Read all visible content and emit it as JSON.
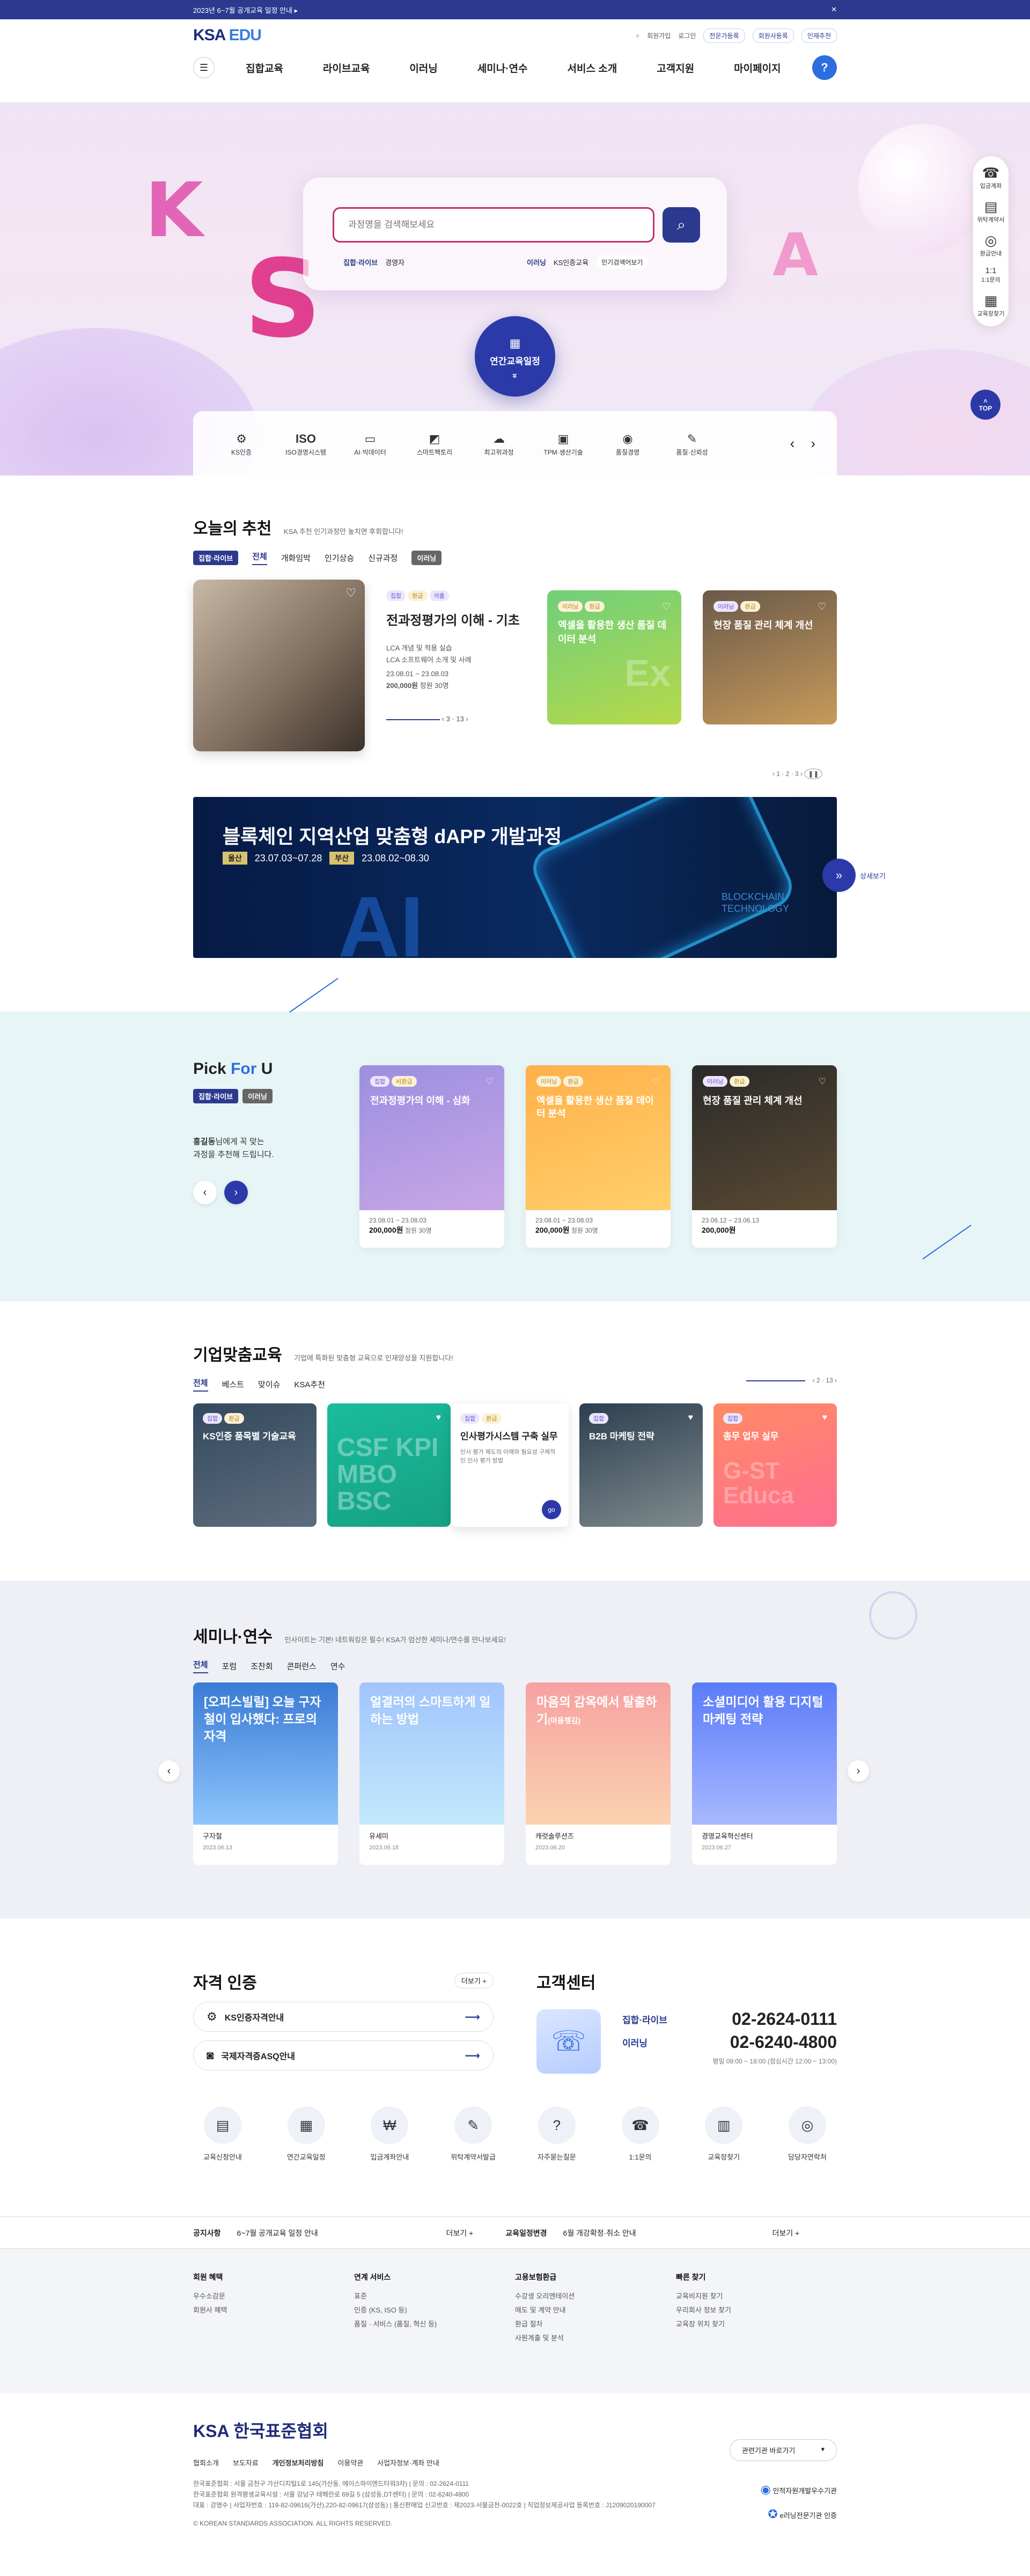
{
  "topbar": {
    "notice": "2023년 6~7월 공개교육 일정 안내 ▸",
    "close": "✕"
  },
  "header": {
    "logo_main": "KSA",
    "logo_sub": " EDU",
    "util": [
      "회원가입",
      "로그인"
    ],
    "util_pills": [
      "전문가등록",
      "회원사등록",
      "인재추천"
    ],
    "gnb": [
      "집합교육",
      "라이브교육",
      "이러닝",
      "세미나·연수",
      "서비스 소개",
      "고객지원",
      "마이페이지"
    ],
    "help": "?"
  },
  "hero": {
    "search_placeholder": "과정명을 검색해보세요",
    "hash": [
      {
        "label": "집합·라이브",
        "value": "경영자"
      },
      {
        "label": "이러닝",
        "value": "KS인증교육"
      }
    ],
    "chip": "인기검색어보기",
    "year_btn": "연간교육일정",
    "year_arrow": "»",
    "quick": [
      {
        "icon": "⚙",
        "label": "KS인증"
      },
      {
        "icon": "ISO",
        "label": "ISO경영시스템"
      },
      {
        "icon": "▭",
        "label": "AI·빅데이터"
      },
      {
        "icon": "◩",
        "label": "스마트팩토리"
      },
      {
        "icon": "☁",
        "label": "최고위과정"
      },
      {
        "icon": "▣",
        "label": "TPM·생산기술"
      },
      {
        "icon": "◉",
        "label": "품질경영"
      },
      {
        "icon": "✎",
        "label": "품질·신뢰성"
      }
    ],
    "quick_nav": [
      "‹",
      "›"
    ],
    "side": [
      {
        "icon": "☎",
        "label": "입금계좌"
      },
      {
        "icon": "▤",
        "label": "위탁계약서"
      },
      {
        "icon": "◎",
        "label": "환급안내"
      },
      {
        "icon": "1:1",
        "label": "1:1문의"
      },
      {
        "icon": "▦",
        "label": "교육장찾기"
      }
    ],
    "top": "TOP"
  },
  "today": {
    "title": "오늘의 추천",
    "sub": "KSA 추천 인기과정만 놓치면 후회합니다!",
    "badges": [
      "집합·라이브",
      "이러닝"
    ],
    "tabs": [
      "전체",
      "개화임박",
      "인기상승",
      "신규과정"
    ],
    "main": {
      "tags": [
        "집합",
        "환급",
        "석출"
      ],
      "title": "전과정평가의 이해 - 기초",
      "desc1": "LCA 개념 및 적용 실습",
      "desc2": "LCA 소프트웨어 소개 및 사례",
      "date": "23.08.01 ~ 23.08.03",
      "price": "200,000원",
      "seats": "정원 30명",
      "pager": "3 · 13"
    },
    "cards": [
      {
        "tags": [
          "이러닝",
          "환급"
        ],
        "title": "엑셀을 활용한 생산 품질 데이터 분석",
        "bg": "Ex"
      },
      {
        "tags": [
          "이러닝",
          "환급"
        ],
        "title": "현장 품질 관리 체계 개선"
      }
    ],
    "pager": "1 · 2 · 3"
  },
  "banner": {
    "title": "블록체인 지역산업 맞춤형 dAPP 개발과정",
    "d1k": "울산",
    "d1": "23.07.03~07.28",
    "d2k": "부산",
    "d2": "23.08.02~08.30",
    "ai": "AI",
    "bc": "BLOCKCHAIN",
    "bc2": "TECHNOLOGY",
    "more": "상세보기"
  },
  "pick": {
    "title_a": "Pick ",
    "title_b": "For",
    "title_c": " U",
    "badges": [
      "집합·라이브",
      "이러닝"
    ],
    "name": "홍길동",
    "desc1": "님에게 꼭 맞는",
    "desc2": "과정을 추천해 드립니다.",
    "cards": [
      {
        "tags": [
          "집합",
          "비환급"
        ],
        "title": "전과정평가의 이해 - 심화",
        "date": "23.08.01 ~ 23.08.03",
        "price": "200,000원",
        "seats": "정원 30명"
      },
      {
        "tags": [
          "이러닝",
          "환급"
        ],
        "title": "엑셀을 활용한 생산 품질 데이터 분석",
        "date": "23.08.01 ~ 23.08.03",
        "price": "200,000원",
        "seats": "정원 30명"
      },
      {
        "tags": [
          "이러닝",
          "환급"
        ],
        "title": "현장 품질 관리 체계 개선",
        "date": "23.06.12 ~ 23.06.13",
        "price": "200,000원",
        "seats": ""
      }
    ]
  },
  "corp": {
    "title": "기업맞춤교육",
    "sub": "기업에 특화된 맞춤형 교육으로 인재양성을 지원합니다!",
    "tabs": [
      "전체",
      "베스트",
      "맞이슈",
      "KSA추천"
    ],
    "pager": "2 · 13",
    "cards": [
      {
        "tags": [
          "집합",
          "환급"
        ],
        "title": "KS인증 품목별 기술교육"
      },
      {
        "title": "",
        "bg": "CSF KPI MBO BSC"
      },
      {
        "tags": [
          "집합",
          "환급"
        ],
        "title": "인사평가시스템 구축 실무",
        "desc": "인사 평가 제도의 이해와 필요성 구체적인 인사 평가 방법"
      },
      {
        "tags": [
          "집합"
        ],
        "title": "B2B 마케팅 전략"
      },
      {
        "tags": [
          "집합"
        ],
        "title": "총무 업무 실무",
        "bg": "G-ST Educa"
      }
    ]
  },
  "seminar": {
    "title": "세미나·연수",
    "sub": "인사이트는 기본! 네트워킹은 필수! KSA가 엄선한 세미나/연수를 만나보세요!",
    "tabs": [
      "전체",
      "포럼",
      "조찬회",
      "콘퍼런스",
      "연수"
    ],
    "cards": [
      {
        "title": "[오피스빌릴] 오늘 구자철이 입사했다: 프로의 자격",
        "name": "구자철",
        "date": "2023.06.13"
      },
      {
        "title": "얼결러의 스마트하게 일하는 방법",
        "name": "유세미",
        "date": "2023.06.18"
      },
      {
        "title": "마음의 감옥에서 탈출하기",
        "title_sub": "(마음챙김)",
        "name": "캐럿솔루션즈",
        "date": "2023.06.20"
      },
      {
        "title": "소셜미디어 활용 디지털 마케팅 전략",
        "name": "경영교육혁신센터",
        "date": "2023.06.27"
      }
    ]
  },
  "cert": {
    "title": "자격 인증",
    "more": "더보기 +",
    "items": [
      "KS인증자격안내",
      "국제자격증ASQ안내"
    ]
  },
  "cs": {
    "title": "고객센터",
    "rows": [
      {
        "label": "집합·라이브",
        "num": "02-2624-0111"
      },
      {
        "label": "이러닝",
        "num": "02-6240-4800"
      }
    ],
    "hours": "평일 09:00 ~ 18:00 (점심시간 12:00 ~ 13:00)"
  },
  "qicons": [
    {
      "icon": "▤",
      "label": "교육신청안내"
    },
    {
      "icon": "▦",
      "label": "연간교육일정"
    },
    {
      "icon": "₩",
      "label": "입금계좌안내"
    },
    {
      "icon": "✎",
      "label": "위탁계약서발급"
    },
    {
      "icon": "?",
      "label": "자주묻는질문"
    },
    {
      "icon": "☎",
      "label": "1:1문의"
    },
    {
      "icon": "▥",
      "label": "교육장찾기"
    },
    {
      "icon": "◎",
      "label": "담당자연락처"
    }
  ],
  "notice": {
    "l1": "공지사항",
    "t1": "6~7월 공개교육 일정 안내",
    "m1": "더보기 +",
    "l2": "교육일정변경",
    "t2": "6월 개강확정·취소 안내",
    "m2": "더보기 +"
  },
  "sitemap": [
    {
      "h": "회원 혜택",
      "items": [
        "우수소감문",
        "회원사 혜택"
      ]
    },
    {
      "h": "연계 서비스",
      "items": [
        "표준",
        "인증 (KS, ISO 등)",
        "품질 · 서비스 (품질, 혁신 등)"
      ]
    },
    {
      "h": "고용보험환급",
      "items": [
        "수강생 오리엔테이션",
        "매도 및 계약 안내",
        "환급 절차",
        "사원계출 및 분석"
      ]
    },
    {
      "h": "빠른 찾기",
      "items": [
        "교육비지원 찾기",
        "우리회사 정보 찾기",
        "교육장 위치 찾기"
      ]
    }
  ],
  "footer": {
    "logo": "KSA 한국표준협회",
    "links": [
      "협회소개",
      "보도자료",
      "개인정보처리방침",
      "이용약관",
      "사업자정보·계좌 안내"
    ],
    "addr1": "한국표준협회 : 서울 금천구 가산디지털1로 145(가산동, 에이스하이엔드타워3차) | 문의 : 02-2624-0111",
    "addr2": "한국표준협회 원격평생교육시설 : 서울 강남구 테헤란로 69길 5 (삼성동,DT센터) | 문의 : 02-6240-4800",
    "addr3": "대표 : 강명수 | 사업자번호 : 119-82-09616(가산),220-82-09617(삼성동) | 통신판매업 신고번호 : 제2023-서울금천-0022호 | 직업정보제공사업 등록번호 : J1209020190007",
    "copy": "© KOREAN STANDARDS ASSOCIATION. ALL RIGHTS RESERVED.",
    "select": "관련기관 바로가기",
    "mark1": "인적자원개발우수기관",
    "mark2": "e러닝전문기관 인증"
  }
}
